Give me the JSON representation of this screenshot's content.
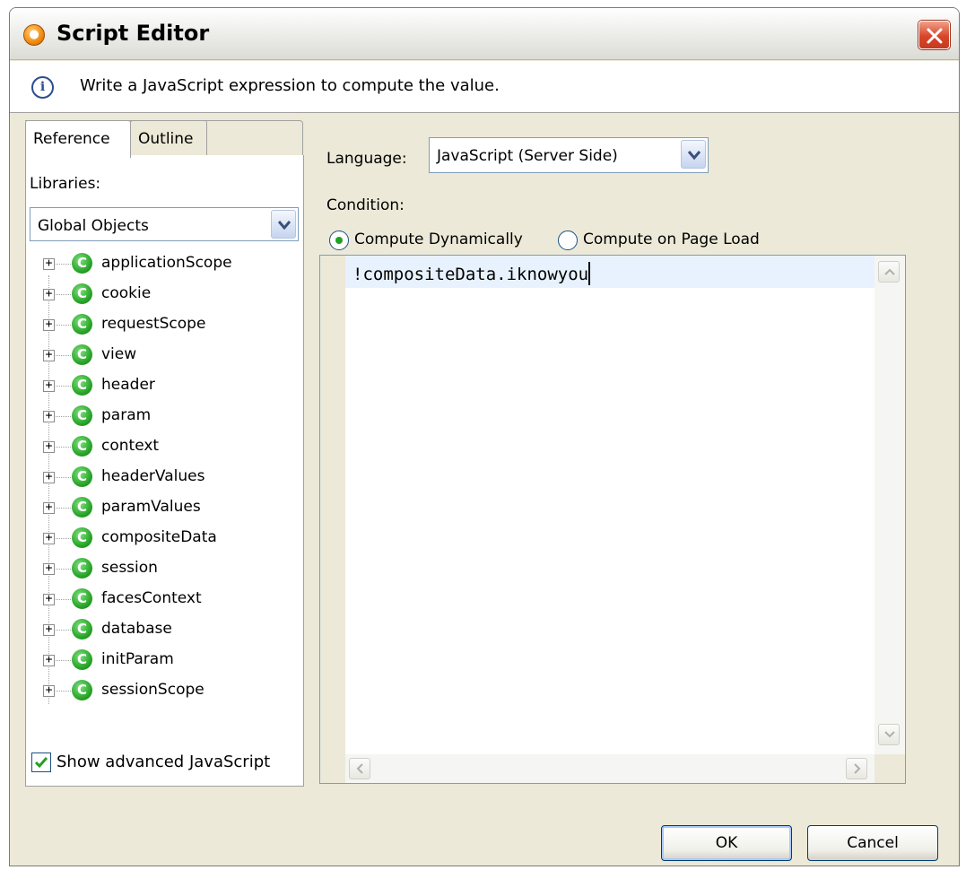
{
  "window": {
    "title": "Script Editor"
  },
  "info": {
    "text": "Write a JavaScript expression to compute the value."
  },
  "left": {
    "tabs": [
      {
        "label": "Reference",
        "active": true
      },
      {
        "label": "Outline",
        "active": false
      }
    ],
    "libraries_label": "Libraries:",
    "libraries_value": "Global Objects",
    "tree": [
      "applicationScope",
      "cookie",
      "requestScope",
      "view",
      "header",
      "param",
      "context",
      "headerValues",
      "paramValues",
      "compositeData",
      "session",
      "facesContext",
      "database",
      "initParam",
      "sessionScope"
    ],
    "tree_icon_letter": "C",
    "show_advanced_label": "Show advanced JavaScript",
    "show_advanced_checked": true
  },
  "right": {
    "language_label": "Language:",
    "language_value": "JavaScript (Server Side)",
    "condition_label": "Condition:",
    "radios": [
      {
        "label": "Compute Dynamically",
        "selected": true
      },
      {
        "label": "Compute on Page Load",
        "selected": false
      }
    ],
    "code": "!compositeData.iknowyou"
  },
  "buttons": {
    "ok": "OK",
    "cancel": "Cancel"
  },
  "colors": {
    "accent": "#21a121",
    "close": "#d8462a",
    "focus_border": "#003c74"
  }
}
